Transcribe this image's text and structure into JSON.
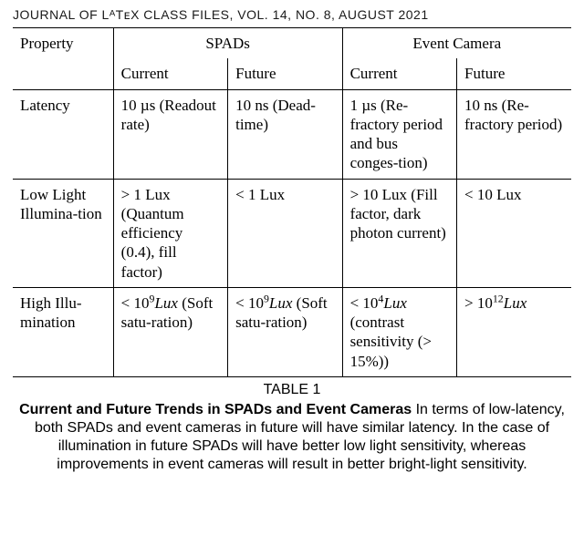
{
  "journal_header": "JOURNAL OF LᴬTᴇX CLASS FILES, VOL. 14, NO. 8, AUGUST 2021",
  "table": {
    "col_property": "Property",
    "group_spads": "SPADs",
    "group_event": "Event Camera",
    "sub_current": "Current",
    "sub_future": "Future",
    "rows": [
      {
        "property": "Latency",
        "spads_current": "10 µs (Readout rate)",
        "spads_future": "10 ns (Dead-time)",
        "event_current": "1 µs (Re-fractory period and bus conges-tion)",
        "event_future": "10 ns (Re-fractory period)"
      },
      {
        "property": "Low Light Illumina-tion",
        "spads_current": "> 1 Lux (Quantum efficiency (0.4), fill factor)",
        "spads_future": "< 1 Lux",
        "event_current": "> 10 Lux (Fill factor, dark photon current)",
        "event_future": "< 10 Lux"
      },
      {
        "property": "High Illu-mination",
        "spads_current_prefix": "< 10",
        "spads_current_exp": "9",
        "spads_current_suffix": " (Soft satu-ration)",
        "spads_future_prefix": "< 10",
        "spads_future_exp": "9",
        "spads_future_suffix": " (Soft satu-ration)",
        "event_current_prefix": "< 10",
        "event_current_exp": "4",
        "event_current_suffix": " (contrast sensitivity (> 15%))",
        "event_future_prefix": "> 10",
        "event_future_exp": "12",
        "event_future_suffix": ""
      }
    ]
  },
  "caption": {
    "label": "TABLE 1",
    "title": "Current and Future Trends in SPADs and Event Cameras",
    "body": " In terms of low-latency, both SPADs and event cameras in future will have similar latency. In the case of illumination in future SPADs will have better low light sensitivity, whereas improvements in event cameras will result in better bright-light sensitivity."
  },
  "chart_data": {
    "type": "table",
    "title": "Current and Future Trends in SPADs and Event Cameras",
    "columns": [
      "Property",
      "SPADs Current",
      "SPADs Future",
      "Event Camera Current",
      "Event Camera Future"
    ],
    "rows": [
      [
        "Latency",
        "10 µs (Readout rate)",
        "10 ns (Dead-time)",
        "1 µs (Refractory period and bus congestion)",
        "10 ns (Refractory period)"
      ],
      [
        "Low Light Illumination",
        "> 1 Lux (Quantum efficiency (0.4), fill factor)",
        "< 1 Lux",
        "> 10 Lux (Fill factor, dark photon current)",
        "< 10 Lux"
      ],
      [
        "High Illumination",
        "< 1e9 Lux (Soft saturation)",
        "< 1e9 Lux (Soft saturation)",
        "< 1e4 Lux (contrast sensitivity (> 15%))",
        "> 1e12 Lux"
      ]
    ]
  }
}
